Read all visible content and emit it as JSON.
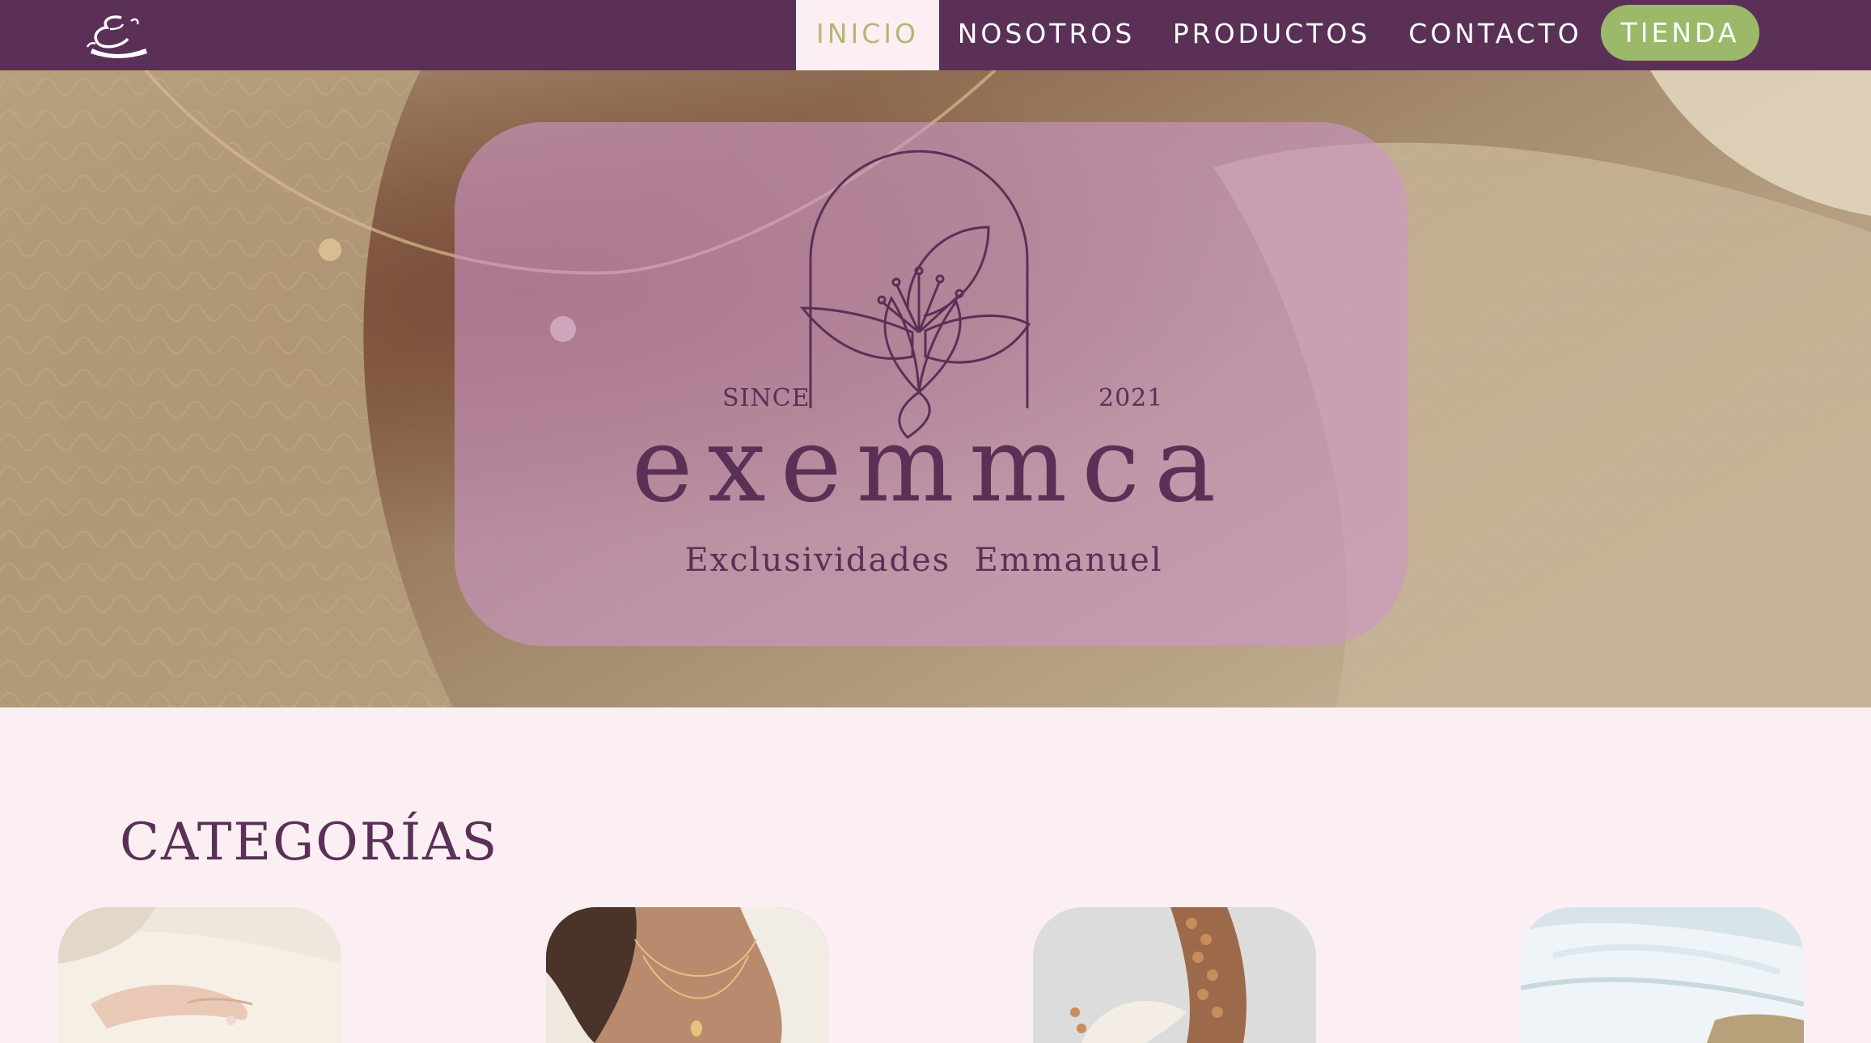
{
  "nav": {
    "items": [
      {
        "label": "INICIO",
        "active": true
      },
      {
        "label": "NOSOTROS",
        "active": false
      },
      {
        "label": "PRODUCTOS",
        "active": false
      },
      {
        "label": "CONTACTO",
        "active": false
      }
    ],
    "store_label": "TIENDA",
    "logo_icon": "script-e-logo-icon"
  },
  "hero": {
    "since_label": "SINCE",
    "year": "2021",
    "brand": "exemmca",
    "tagline": "Exclusividades  Emmanuel",
    "emblem_icon": "lily-arch-icon"
  },
  "categories": {
    "title": "CATEGORÍAS",
    "cards": [
      {
        "image": "hands-jewelry-photo"
      },
      {
        "image": "necklace-photo"
      },
      {
        "image": "bracelets-photo"
      },
      {
        "image": "towel-photo"
      }
    ]
  },
  "colors": {
    "primary": "#5a3057",
    "active_text": "#b8b574",
    "accent": "#9cb96a",
    "page_bg": "#fbeff4"
  }
}
